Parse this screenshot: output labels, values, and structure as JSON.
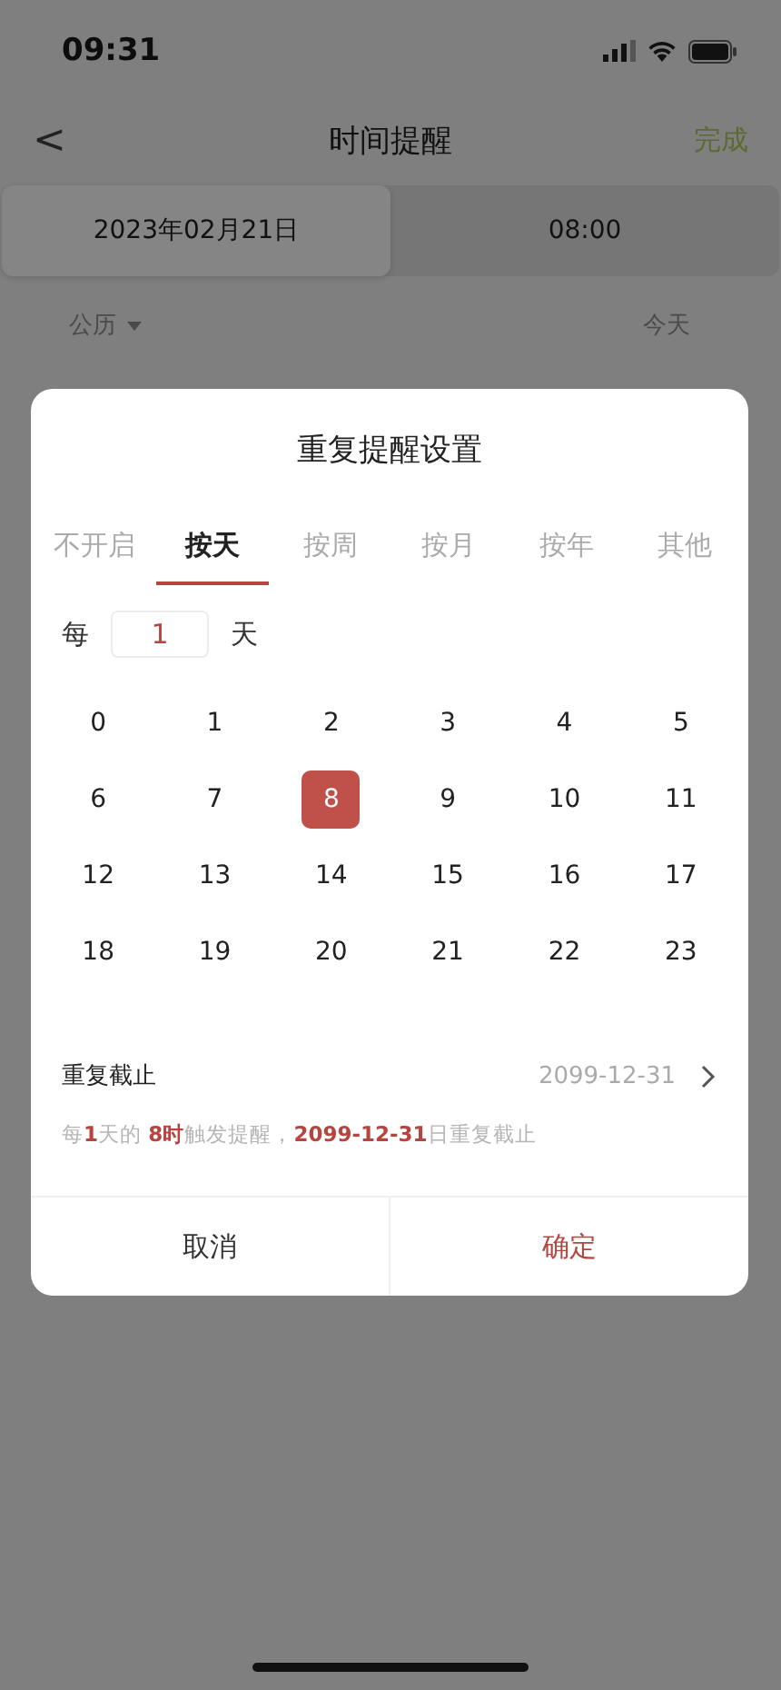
{
  "status_bar": {
    "time": "09:31"
  },
  "nav": {
    "back": "<",
    "title": "时间提醒",
    "done": "完成"
  },
  "segments": [
    {
      "label": "2023年02月21日",
      "selected": true
    },
    {
      "label": "08:00",
      "selected": false
    }
  ],
  "calendar": {
    "type": "公历",
    "today": "今天"
  },
  "dialog": {
    "title": "重复提醒设置",
    "tabs": [
      {
        "label": "不开启",
        "selected": false
      },
      {
        "label": "按天",
        "selected": true
      },
      {
        "label": "按周",
        "selected": false
      },
      {
        "label": "按月",
        "selected": false
      },
      {
        "label": "按年",
        "selected": false
      },
      {
        "label": "其他",
        "selected": false
      }
    ],
    "interval": {
      "prefix": "每",
      "value": "1",
      "unit": "天"
    },
    "hours": [
      {
        "label": "0",
        "selected": false
      },
      {
        "label": "1",
        "selected": false
      },
      {
        "label": "2",
        "selected": false
      },
      {
        "label": "3",
        "selected": false
      },
      {
        "label": "4",
        "selected": false
      },
      {
        "label": "5",
        "selected": false
      },
      {
        "label": "6",
        "selected": false
      },
      {
        "label": "7",
        "selected": false
      },
      {
        "label": "8",
        "selected": true
      },
      {
        "label": "9",
        "selected": false
      },
      {
        "label": "10",
        "selected": false
      },
      {
        "label": "11",
        "selected": false
      },
      {
        "label": "12",
        "selected": false
      },
      {
        "label": "13",
        "selected": false
      },
      {
        "label": "14",
        "selected": false
      },
      {
        "label": "15",
        "selected": false
      },
      {
        "label": "16",
        "selected": false
      },
      {
        "label": "17",
        "selected": false
      },
      {
        "label": "18",
        "selected": false
      },
      {
        "label": "19",
        "selected": false
      },
      {
        "label": "20",
        "selected": false
      },
      {
        "label": "21",
        "selected": false
      },
      {
        "label": "22",
        "selected": false
      },
      {
        "label": "23",
        "selected": false
      }
    ],
    "end": {
      "label": "重复截止",
      "value": "2099-12-31"
    },
    "summary": "每**1**天的 **8时**触发提醒，**2099-12-31**日重复截止",
    "buttons": {
      "cancel": "取消",
      "confirm": "确定"
    }
  }
}
